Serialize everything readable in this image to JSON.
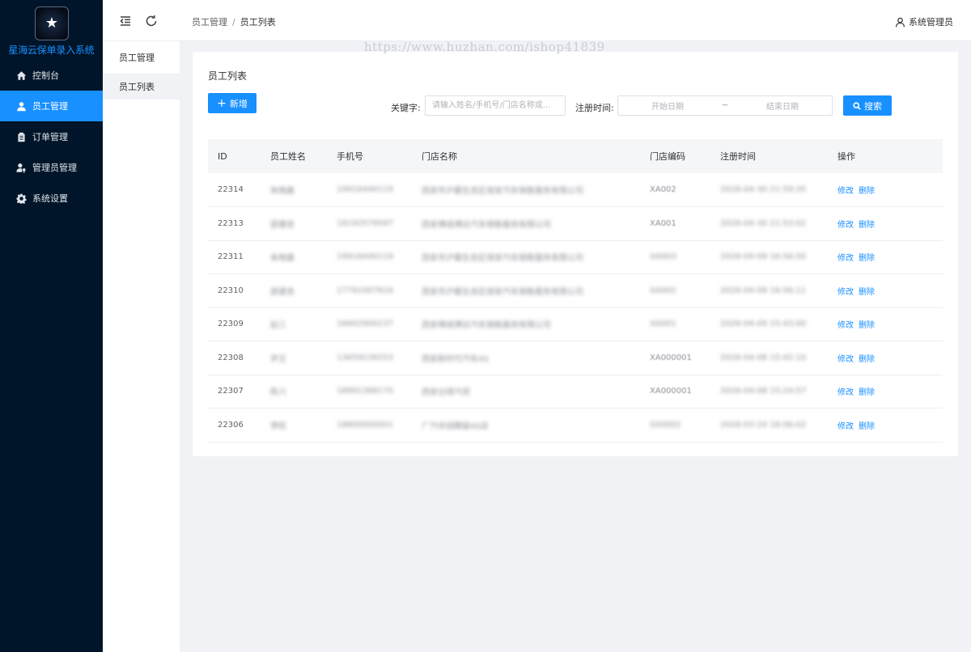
{
  "app": {
    "title": "星海云保单录入系统"
  },
  "sidebar": {
    "items": [
      {
        "label": "控制台",
        "icon": "home-icon",
        "active": false
      },
      {
        "label": "员工管理",
        "icon": "user-icon",
        "active": true
      },
      {
        "label": "订单管理",
        "icon": "clipboard-icon",
        "active": false
      },
      {
        "label": "管理员管理",
        "icon": "user-key-icon",
        "active": false
      },
      {
        "label": "系统设置",
        "icon": "gear-icon",
        "active": false
      }
    ]
  },
  "header": {
    "breadcrumb": [
      "员工管理",
      "员工列表"
    ],
    "user": "系统管理员"
  },
  "submenu": {
    "title": "员工管理",
    "items": [
      "员工列表"
    ]
  },
  "watermark": "https://www.huzhan.com/ishop41839",
  "card": {
    "title": "员工列表",
    "add_label": "新增",
    "keyword_label": "关键字:",
    "keyword_placeholder": "请输入姓名/手机号/门店名称或...",
    "date_label": "注册时间:",
    "start_placeholder": "开始日期",
    "end_placeholder": "结束日期",
    "search_label": "搜索"
  },
  "table": {
    "columns": [
      "ID",
      "员工姓名",
      "手机号",
      "门店名称",
      "门店编码",
      "注册时间",
      "操作"
    ],
    "edit_label": "修改",
    "delete_label": "删除",
    "rows": [
      {
        "id": "22314",
        "name": "朱晓鑫",
        "phone": "19916440119",
        "store": "西安市沪霸生态区保安汽车销售服务有限公司",
        "code": "XA002",
        "time": "2026-04-30 21:59:35"
      },
      {
        "id": "22313",
        "name": "邵建忠",
        "phone": "18192579597",
        "store": "西安傅成博达汽车销售服务有限公司",
        "code": "XA001",
        "time": "2026-04-30 21:53:02"
      },
      {
        "id": "22311",
        "name": "朱晓鑫",
        "phone": "19916440119",
        "store": "西安市沪霸生态区保安汽车销售服务有限公司",
        "code": "XA003",
        "time": "2026-04-09 16:56:50"
      },
      {
        "id": "22310",
        "name": "邵建忠",
        "phone": "17791007616",
        "store": "西安市沪霸生态区保安汽车销售服务有限公司",
        "code": "XA002",
        "time": "2026-04-09 16:56:11"
      },
      {
        "id": "22309",
        "name": "赵三",
        "phone": "16602900237",
        "store": "西安傅成博达汽车销售服务有限公司",
        "code": "XA001",
        "time": "2026-04-09 15:43:00"
      },
      {
        "id": "22308",
        "name": "尹王",
        "phone": "13659236253",
        "store": "西安新时代汽车4S",
        "code": "XA000001",
        "time": "2026-04-08 15:42:10"
      },
      {
        "id": "22307",
        "name": "陈六",
        "phone": "18991368170",
        "store": "西安记得汽贸",
        "code": "XA000001",
        "time": "2026-04-08 15:24:57"
      },
      {
        "id": "22306",
        "name": "李旺",
        "phone": "18800000001",
        "store": "广汽丰田腾骏4S店",
        "code": "SX0002",
        "time": "2026-03-24 18:06:02"
      }
    ]
  }
}
